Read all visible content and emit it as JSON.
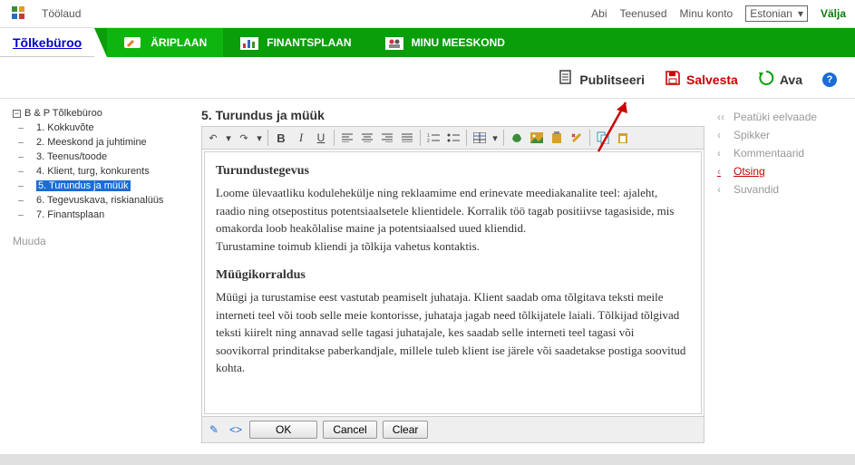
{
  "top": {
    "crumb": "Töölaud",
    "abi": "Abi",
    "teenused": "Teenused",
    "minu_konto": "Minu konto",
    "lang": "Estonian",
    "valja": "Välja"
  },
  "nav": {
    "brand": "Tõlkebüroo",
    "ariplaan": "ÄRIPLAAN",
    "finants": "FINANTSPLAAN",
    "meeskond": "MINU MEESKOND"
  },
  "actions": {
    "publitseeri": "Publitseeri",
    "salvesta": "Salvesta",
    "ava": "Ava"
  },
  "tree": {
    "root": "B & P Tõlkebüroo",
    "items": [
      "1. Kokkuvõte",
      "2. Meeskond ja juhtimine",
      "3. Teenus/toode",
      "4. Klient, turg, konkurents",
      "5. Turundus ja müük",
      "6. Tegevuskava, riskianalüüs",
      "7. Finantsplaan"
    ],
    "muuda": "Muuda"
  },
  "section": {
    "title": "5.  Turundus ja müük"
  },
  "editor": {
    "h1": "Turundustegevus",
    "p1": "Loome ülevaatliku kodulehekülje ning reklaamime end erinevate meediakanalite teel: ajaleht, raadio ning otsepostitus potentsiaalsetele klientidele. Korralik töö tagab positiivse tagasiside, mis omakorda loob heakõlalise maine ja potentsiaalsed uued kliendid.\nTurustamine toimub kliendi ja tõlkija vahetus kontaktis.",
    "h2": "Müügikorraldus",
    "p2": "Müügi ja turustamise eest vastutab peamiselt juhataja. Klient saadab oma tõlgitava teksti meile interneti teel või toob selle meie kontorisse, juhataja jagab need tõlkijatele laiali. Tõlkijad tõlgivad teksti kiirelt ning annavad selle tagasi juhatajale, kes saadab selle interneti teel tagasi või soovikorral prinditakse paberkandjale, millele tuleb klient ise järele või saadetakse postiga soovitud kohta.",
    "ok": "OK",
    "cancel": "Cancel",
    "clear": "Clear"
  },
  "side": {
    "peatuki": "Peatüki eelvaade",
    "spikker": "Spikker",
    "kommentaarid": "Kommentaarid",
    "otsing": "Otsing",
    "suvandid": "Suvandid"
  }
}
